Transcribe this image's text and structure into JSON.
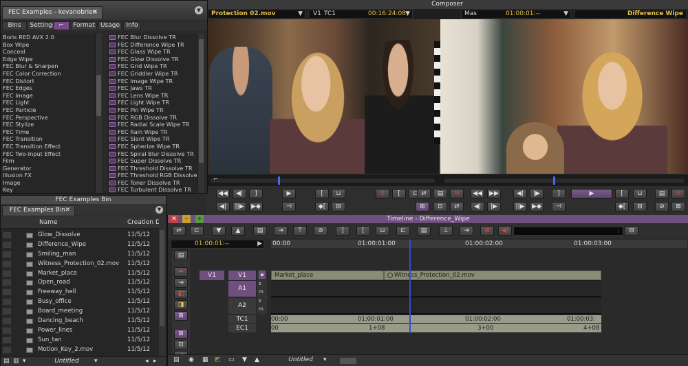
{
  "project_window": {
    "title": "FEC Examples - kevanobrien",
    "tabs": [
      "Bins",
      "Settings",
      "",
      "Format",
      "Usage",
      "Info"
    ],
    "categories": [
      "Boris RED AVX 2.0",
      "Box Wipe",
      "Conceal",
      "Edge Wipe",
      "FEC Blur & Sharpen",
      "FEC Color Correction",
      "FEC Distort",
      "FEC Edges",
      "FEC Image",
      "FEC Light",
      "FEC Particle",
      "FEC Perspective",
      "FEC Stylize",
      "FEC Time",
      "FEC Transition",
      "FEC Transition Effect",
      "FEC Two-Input Effect",
      "Film",
      "Generator",
      "Illusion FX",
      "Image",
      "Key"
    ],
    "effects": [
      "FEC Blur Dissolve TR",
      "FEC Difference Wipe TR",
      "FEC Glass Wipe TR",
      "FEC Glow Dissolve TR",
      "FEC Grid Wipe TR",
      "FEC Griddler Wipe TR",
      "FEC Image Wipe TR",
      "FEC Jaws TR",
      "FEC Lens Wipe TR",
      "FEC Light Wipe TR",
      "FEC Pin Wipe TR",
      "FEC RGB Dissolve TR",
      "FEC Radial Scale Wipe TR",
      "FEC Rain Wipe TR",
      "FEC Slant Wipe TR",
      "FEC Spherize Wipe TR",
      "FEC Spiral Blur Dissolve TR",
      "FEC Super Dissolve TR",
      "FEC Threshold Dissolve TR",
      "FEC Threshold RGB Dissolve",
      "FEC Toner Dissolve TR",
      "FEC Turbulent Dissolve TR"
    ]
  },
  "bin_window": {
    "title": "FEC Examples Bin",
    "tab_label": "FEC Examples Bin",
    "col_name": "Name",
    "col_date": "Creation Dat",
    "rows": [
      {
        "name": "Glow_Dissolve",
        "date": "11/5/12"
      },
      {
        "name": "Difference_Wipe",
        "date": "11/5/12"
      },
      {
        "name": "Smiling_man",
        "date": "11/5/12"
      },
      {
        "name": "Witness_Protection_02.mov",
        "date": "11/5/12"
      },
      {
        "name": "Market_place",
        "date": "11/5/12"
      },
      {
        "name": "Open_road",
        "date": "11/5/12"
      },
      {
        "name": "Freeway_hell",
        "date": "11/5/12"
      },
      {
        "name": "Busy_office",
        "date": "11/5/12"
      },
      {
        "name": "Board_meeting",
        "date": "11/5/12"
      },
      {
        "name": "Dancing_beach",
        "date": "11/5/12"
      },
      {
        "name": "Power_lines",
        "date": "11/5/12"
      },
      {
        "name": "Sun_tan",
        "date": "11/5/12"
      },
      {
        "name": "Motion_Key_2.mov",
        "date": "11/5/12"
      }
    ],
    "footer_label": "Untitled"
  },
  "composer": {
    "title": "Composer",
    "source_clip": "Protection 02.mov",
    "source_track": "V1",
    "source_tc_label": "TC1",
    "source_tc": "00:16:24:08",
    "record_mode": "Mas",
    "record_tc": "01:00:01:--",
    "record_clip": "Difference Wipe",
    "mark_count": "0"
  },
  "timeline": {
    "title": "Timeline - Difference_Wipe",
    "current_tc": "01:00:01:--",
    "ruler": [
      "00:00",
      "01:00:01:00",
      "01:00:02:00",
      "01:00:03:00"
    ],
    "tracks": {
      "v1_src": "V1",
      "v1": "V1",
      "a1": "A1",
      "a2": "A2",
      "tc1": "TC1",
      "ec1": "EC1"
    },
    "clips": {
      "clip1": "Market_place",
      "clip2": "Witness_Protection_02.mov"
    },
    "tc_ruler": [
      "00:00",
      "01:00:01:00",
      "01:00:02:00",
      "01:00:03:"
    ],
    "ec_ruler": [
      "00",
      "1+08",
      "3+00",
      "4+08"
    ],
    "footer_label": "Untitled"
  },
  "colors": {
    "accent_purple": "#6e4f80",
    "playhead": "#3a4ac8",
    "clip": "#8a8c74"
  }
}
